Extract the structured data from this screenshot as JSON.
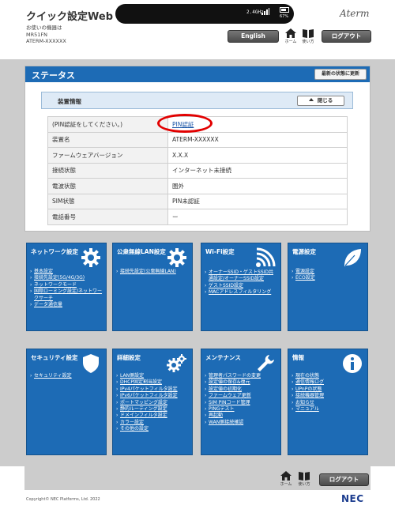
{
  "header": {
    "app_title": "クイック設定Web",
    "device_label": "お使いの機器は",
    "device_model": "MR51FN",
    "device_id": "ATERM-XXXXXX",
    "signal_value": "2.4GHz",
    "battery_text": "67%",
    "brand": "Aterm",
    "english_label": "English",
    "home_label": "ホーム",
    "guide_label": "使い方",
    "logout_label": "ログアウト"
  },
  "status": {
    "title": "ステータス",
    "refresh_label": "最新の状態に更新",
    "section_title": "装置情報",
    "close_label": "閉じる",
    "rows": [
      {
        "label": "(PIN認証をしてください。)",
        "value": "PIN認証"
      },
      {
        "label": "装置名",
        "value": "ATERM-XXXXXX"
      },
      {
        "label": "ファームウェアバージョン",
        "value": "X.X.X"
      },
      {
        "label": "接続状態",
        "value": "インターネット未接続"
      },
      {
        "label": "電波状態",
        "value": "圏外"
      },
      {
        "label": "SIM状態",
        "value": "PIN未認証"
      },
      {
        "label": "電話番号",
        "value": "ー"
      }
    ]
  },
  "tiles": [
    {
      "title": "ネットワーク設定",
      "icon": "gear-icon",
      "items": [
        "基本設定",
        "接続先設定(5G/4G/3G)",
        "ネットワークモード",
        "国際ローミング設定/ネットワークサーチ",
        "データ通信量"
      ]
    },
    {
      "title": "公衆無線LAN設定",
      "icon": "gear-icon",
      "items": [
        "接続先設定(公衆無線LAN)"
      ]
    },
    {
      "title": "Wi-Fi設定",
      "icon": "wifi-icon",
      "items": [
        "オーナーSSID・ゲストSSID共通設定/オーナーSSID設定",
        "ゲストSSID設定",
        "MACアドレスフィルタリング"
      ]
    },
    {
      "title": "電源設定",
      "icon": "leaf-icon",
      "items": [
        "電源設定",
        "ECO設定"
      ]
    },
    {
      "title": "セキュリティ設定",
      "icon": "shield-icon",
      "items": [
        "セキュリティ設定"
      ]
    },
    {
      "title": "詳細設定",
      "icon": "gears-icon",
      "items": [
        "LAN側設定",
        "DHCP固定割当設定",
        "IPv4パケットフィルタ設定",
        "IPv6パケットフィルタ設定",
        "ポートマッピング設定",
        "静的ルーティング設定",
        "ドメインフィルタ設定",
        "カラー設定",
        "その他の設定"
      ]
    },
    {
      "title": "メンテナンス",
      "icon": "wrench-icon",
      "items": [
        "管理者パスワードの変更",
        "設定値の保存&復元",
        "設定値の初期化",
        "ファームウェア更新",
        "SIM PINコード管理",
        "PINGテスト",
        "再起動",
        "WAN側接続確認"
      ]
    },
    {
      "title": "情報",
      "icon": "info-icon",
      "items": [
        "現在の状態",
        "通信情報ログ",
        "UPnPの状態",
        "接続機器管理",
        "お知らせ",
        "マニュアル"
      ]
    }
  ],
  "footer": {
    "home_label": "ホーム",
    "guide_label": "使い方",
    "logout_label": "ログアウト",
    "copyright": "Copyright© NEC Platforms, Ltd. 2022",
    "logo": "NEC"
  },
  "colors": {
    "accent": "#1d6bb5",
    "highlight_ring": "#e20000",
    "content_bg": "#cccccc"
  }
}
